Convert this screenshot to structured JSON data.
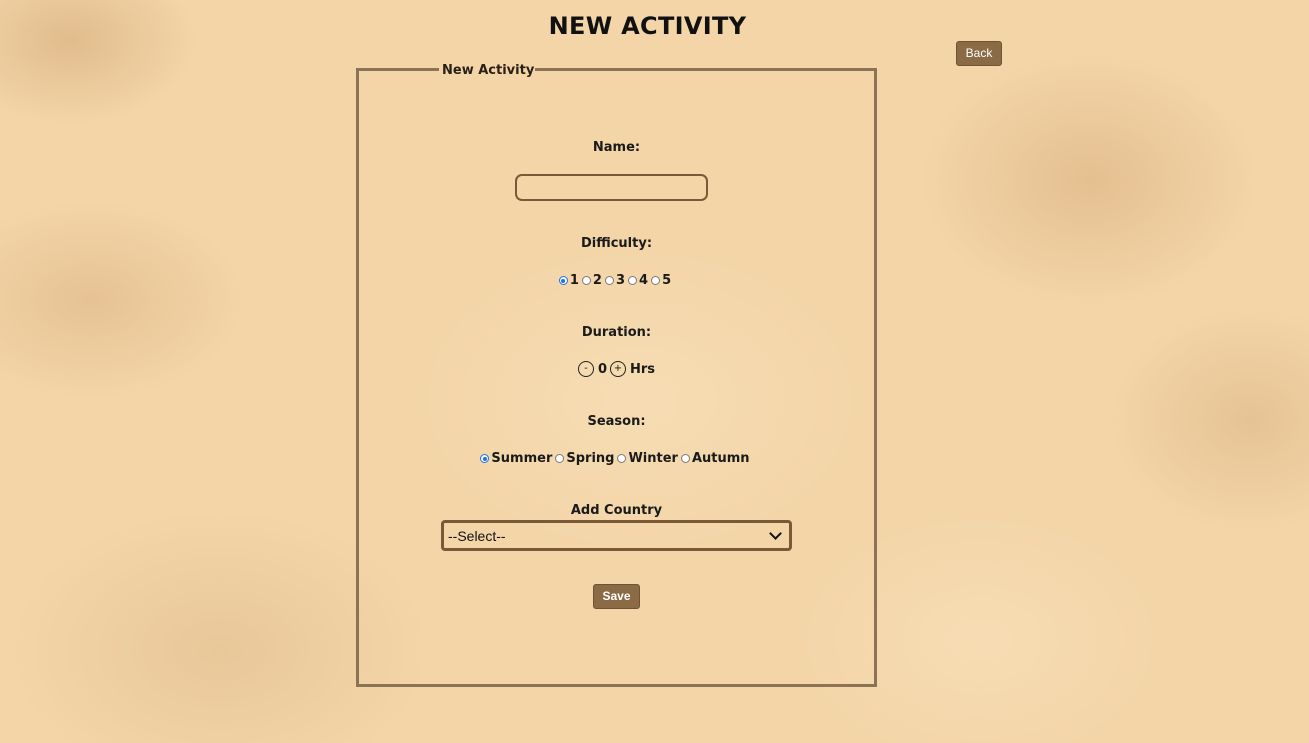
{
  "page": {
    "title": "NEW ACTIVITY"
  },
  "nav": {
    "back_label": "Back"
  },
  "form": {
    "legend": "New Activity",
    "name": {
      "label": "Name:",
      "value": "",
      "placeholder": ""
    },
    "difficulty": {
      "label": "Difficulty:",
      "options": [
        "1",
        "2",
        "3",
        "4",
        "5"
      ],
      "selected": "1"
    },
    "duration": {
      "label": "Duration:",
      "decrement_label": "-",
      "increment_label": "+",
      "value": "0",
      "unit": "Hrs"
    },
    "season": {
      "label": "Season:",
      "options": [
        "Summer",
        "Spring",
        "Winter",
        "Autumn"
      ],
      "selected": "Summer"
    },
    "country": {
      "label": "Add Country",
      "selected_option": "--Select--"
    },
    "save_label": "Save"
  },
  "colors": {
    "button_bg": "#8b6b45",
    "border": "#8b7355",
    "radio_checked": "#1a73e8"
  }
}
